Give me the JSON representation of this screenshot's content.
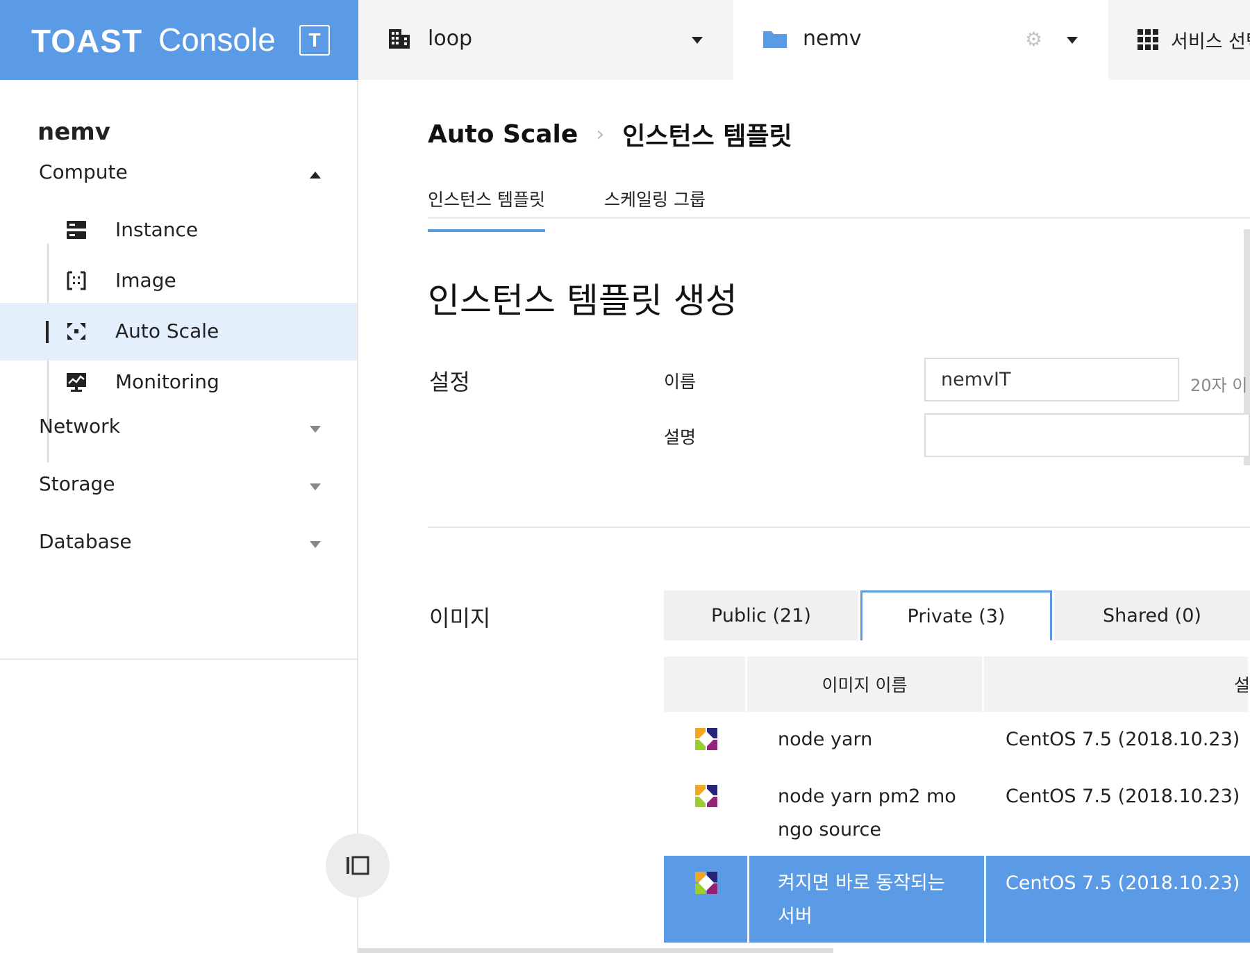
{
  "header": {
    "brand_toast": "TOAST",
    "brand_console": "Console",
    "brand_logo_letter": "T",
    "org": {
      "name": "loop",
      "icon": "building-icon"
    },
    "project": {
      "name": "nemv",
      "icon": "folder-icon"
    },
    "service": {
      "label": "서비스 선택",
      "icon": "apps-grid-icon"
    }
  },
  "sidebar": {
    "project_name": "nemv",
    "categories": [
      {
        "label": "Compute",
        "expanded": true
      },
      {
        "label": "Network",
        "expanded": false
      },
      {
        "label": "Storage",
        "expanded": false
      },
      {
        "label": "Database",
        "expanded": false
      }
    ],
    "compute_items": [
      {
        "label": "Instance",
        "icon": "server-icon",
        "active": false
      },
      {
        "label": "Image",
        "icon": "image-icon",
        "active": false
      },
      {
        "label": "Auto Scale",
        "icon": "autoscale-icon",
        "active": true
      },
      {
        "label": "Monitoring",
        "icon": "monitoring-icon",
        "active": false
      }
    ]
  },
  "main": {
    "breadcrumb": [
      "Auto Scale",
      "인스턴스 템플릿"
    ],
    "tabs": [
      {
        "label": "인스턴스 템플릿",
        "active": true
      },
      {
        "label": "스케일링 그룹",
        "active": false
      }
    ],
    "page_title": "인스턴스 템플릿 생성",
    "settings": {
      "section_label": "설정",
      "name_label": "이름",
      "name_value": "nemvIT",
      "name_hint": "20자 이",
      "desc_label": "설명",
      "desc_value": ""
    },
    "image": {
      "section_label": "이미지",
      "tabs": [
        {
          "label": "Public (21)",
          "active": false
        },
        {
          "label": "Private (3)",
          "active": true
        },
        {
          "label": "Shared (0)",
          "active": false
        }
      ],
      "columns": [
        "",
        "이미지 이름",
        "설명"
      ],
      "rows": [
        {
          "icon": "centos-logo-icon",
          "name": "node yarn",
          "desc": "CentOS 7.5 (2018.10.23)",
          "selected": false
        },
        {
          "icon": "centos-logo-icon",
          "name": "node yarn pm2 mongo source",
          "desc": "CentOS 7.5 (2018.10.23)",
          "selected": false
        },
        {
          "icon": "centos-logo-icon",
          "name": "켜지면 바로 동작되는 서버",
          "desc": "CentOS 7.5 (2018.10.23)",
          "selected": true
        }
      ]
    }
  },
  "colors": {
    "accent": "#5b9be6",
    "active_item_bg": "#e4effc",
    "tab_bg": "#f0f0f0"
  }
}
